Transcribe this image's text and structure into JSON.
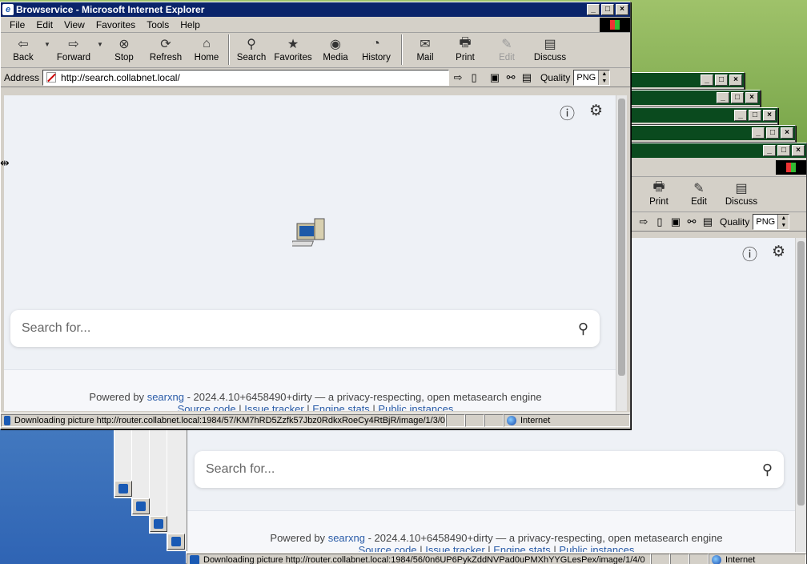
{
  "background_windows": {
    "toolbar": {
      "print": "Print",
      "edit": "Edit",
      "discuss": "Discuss"
    },
    "quality_label": "Quality",
    "quality_value": "PNG",
    "search_placeholder": "Search for...",
    "footer": {
      "powered_by": "Powered by",
      "searxng_link": "searxng",
      "version_text": "- 2024.4.10+6458490+dirty — a privacy-respecting, open metasearch engine",
      "links": [
        "Source code",
        "Issue tracker",
        "Engine stats",
        "Public instances"
      ]
    },
    "status_text": "Downloading picture http://router.collabnet.local:1984/56/0n6UP6PykZddNVPad0uPMXhYYGLesPex/image/1/4/0",
    "zone": "Internet"
  },
  "main_window": {
    "title": "Browservice - Microsoft Internet Explorer",
    "menu": [
      "File",
      "Edit",
      "View",
      "Favorites",
      "Tools",
      "Help"
    ],
    "toolbar": {
      "back": "Back",
      "forward": "Forward",
      "stop": "Stop",
      "refresh": "Refresh",
      "home": "Home",
      "search": "Search",
      "favorites": "Favorites",
      "media": "Media",
      "history": "History",
      "mail": "Mail",
      "print": "Print",
      "edit": "Edit",
      "discuss": "Discuss"
    },
    "address_label": "Address",
    "address_value": "http://search.collabnet.local/",
    "quality_label": "Quality",
    "quality_value": "PNG",
    "page": {
      "search_placeholder": "Search for...",
      "footer": {
        "powered_by": "Powered by",
        "searxng_link": "searxng",
        "version_text": "- 2024.4.10+6458490+dirty — a privacy-respecting, open metasearch engine",
        "links": [
          "Source code",
          "Issue tracker",
          "Engine stats",
          "Public instances"
        ]
      }
    },
    "status_text": "Downloading picture http://router.collabnet.local:1984/57/KM7hRD5Zzfk57Jbz0RdkxRoeCy4RtBjR/image/1/3/0",
    "zone": "Internet"
  },
  "icons": {
    "info": "info-icon",
    "settings": "gear-icon",
    "search": "search-icon",
    "loading": "computer-loading-icon"
  },
  "colors": {
    "active_title": "#0a246a",
    "inactive_title": "#0a4a1e",
    "link": "#2a5ca8",
    "page_bg": "#eef1f6"
  }
}
